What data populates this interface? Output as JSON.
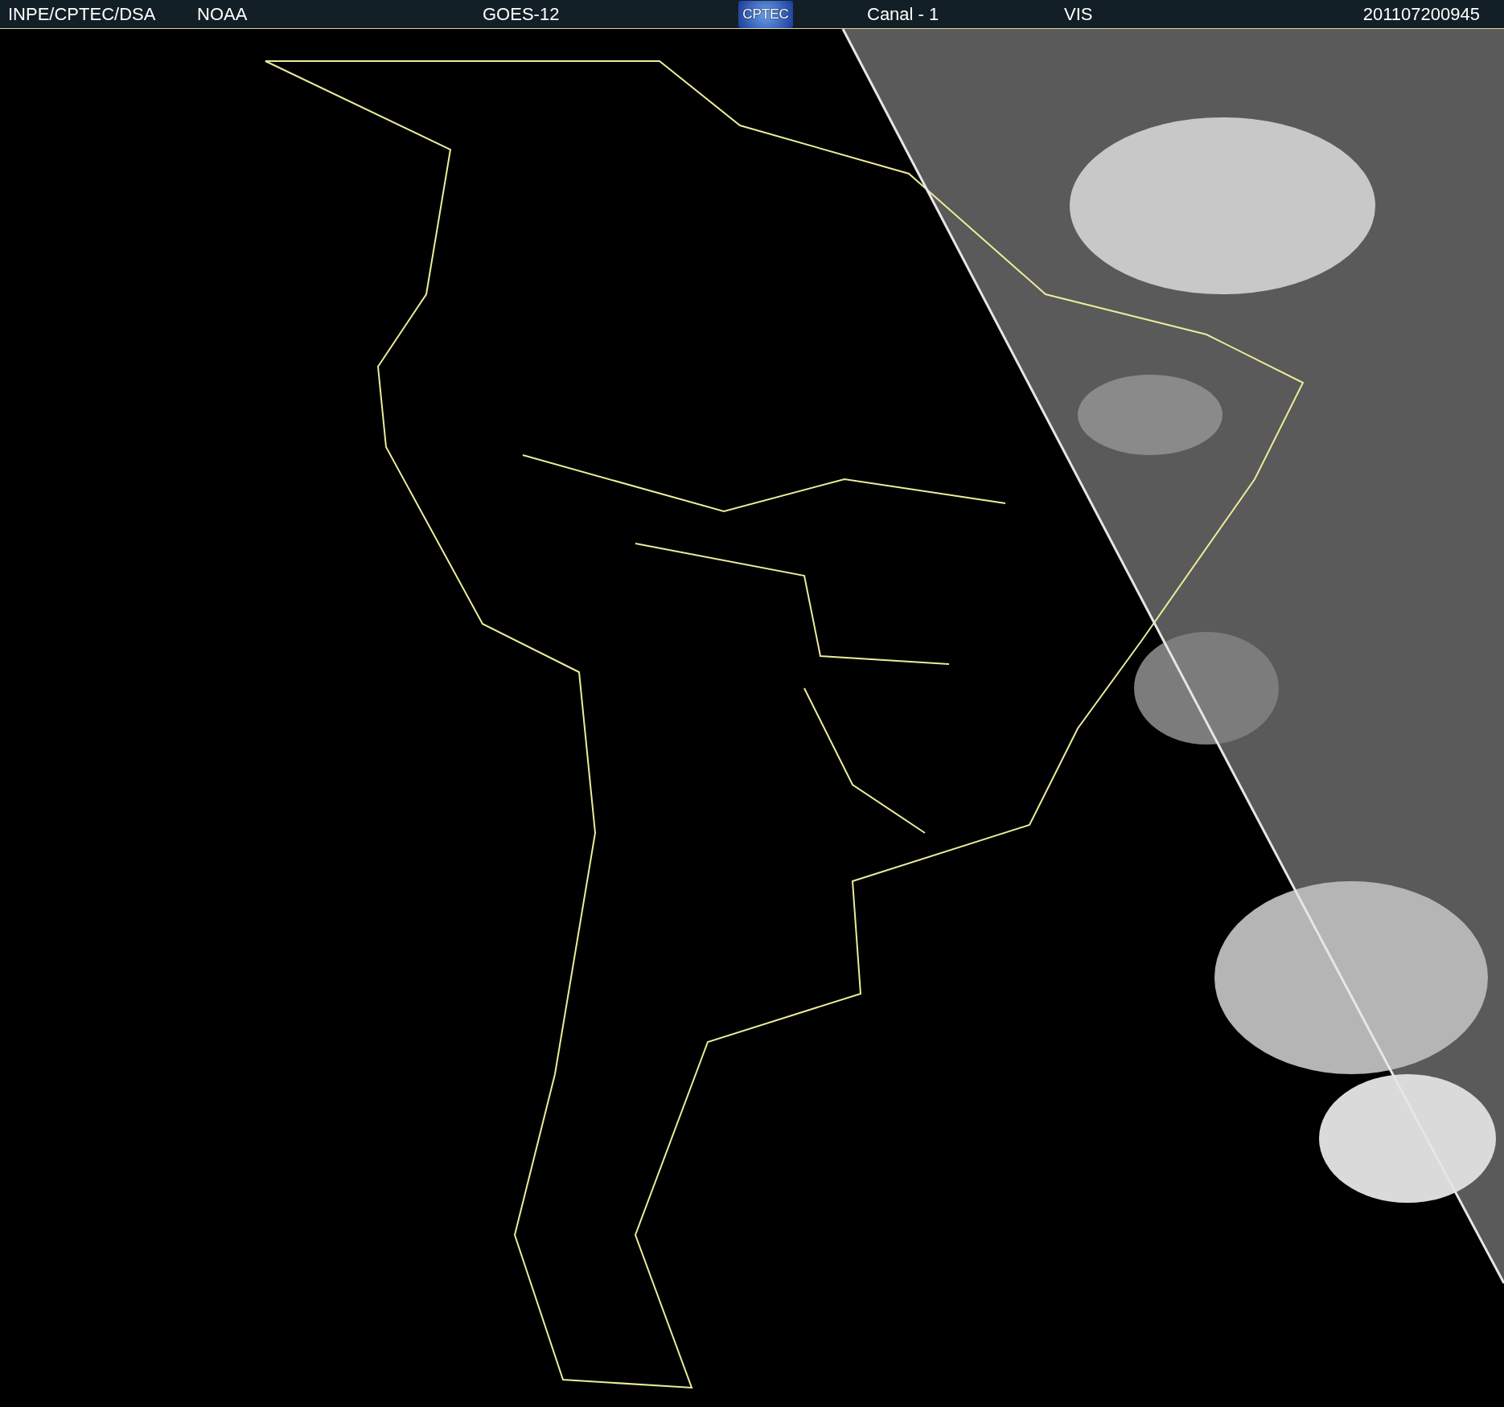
{
  "header": {
    "items": [
      {
        "text": "INPE/CPTEC/DSA"
      },
      {
        "text": "NOAA"
      },
      {
        "text": "GOES-12"
      },
      {
        "kind": "logo",
        "text": "CPTEC"
      },
      {
        "text": "Canal - 1"
      },
      {
        "text": "VIS"
      },
      {
        "text": "201107200945"
      }
    ]
  }
}
